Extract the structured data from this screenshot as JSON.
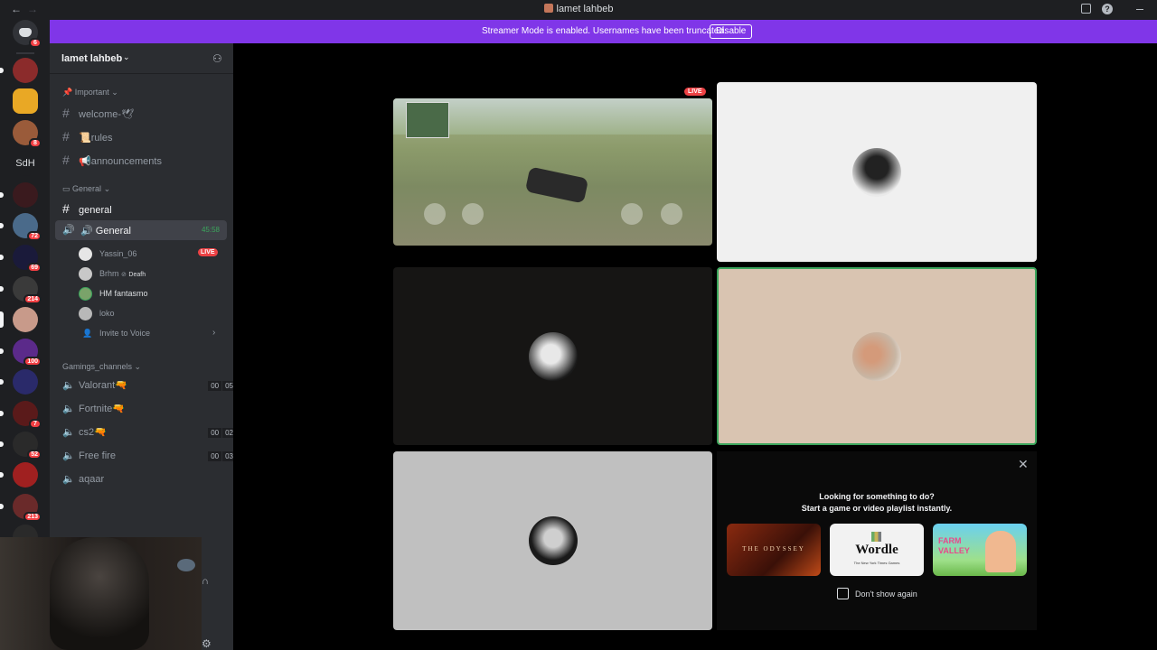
{
  "titlebar": {
    "title": "lamet lahbeb"
  },
  "banner": {
    "message": "Streamer Mode is enabled. Usernames have been truncated.",
    "button": "Disable"
  },
  "servers": {
    "home_badge": "6",
    "badges": [
      "8",
      "72",
      "69",
      "214",
      "100",
      "7",
      "52",
      "213"
    ],
    "text_icon": "SdH"
  },
  "server": {
    "name": "lamet lahbeb"
  },
  "categories": {
    "important": "Important",
    "general": "General",
    "gaming": "Gamings_channels"
  },
  "channels": {
    "welcome": "welcome-🕊",
    "rules": "📜rules",
    "announcements": "📢announcements",
    "general_text": "general",
    "general_voice": "General",
    "general_voice_time": "45:58",
    "valorant": "Valorant🔫",
    "fortnite": "Fortnite🔫",
    "cs2": "cs2🔫",
    "freefire": "Free fire",
    "aqaar": "aqaar"
  },
  "voice_members": [
    {
      "name": "Yassin_06",
      "tag": "LIVE"
    },
    {
      "name": "Brhm",
      "status": "Deafh"
    },
    {
      "name": "HM fantasmo"
    },
    {
      "name": "loko"
    }
  ],
  "invite": "Invite to Voice",
  "counts": {
    "valorant": [
      "00",
      "05"
    ],
    "cs2": [
      "00",
      "02"
    ],
    "freefire": [
      "00",
      "03"
    ]
  },
  "stream": {
    "live_label": "LIVE"
  },
  "activity": {
    "line1": "Looking for something to do?",
    "line2": "Start a game or video playlist instantly.",
    "games": [
      "THE ODYSSEY",
      "Wordle",
      "FARM VALLEY"
    ],
    "wordle_sub": "The New York Times Games",
    "dont_show": "Don't show again"
  },
  "colors": {
    "streamer_banner": "#8036e8",
    "live_red": "#ed4245",
    "speaking_green": "#3ba55c"
  }
}
